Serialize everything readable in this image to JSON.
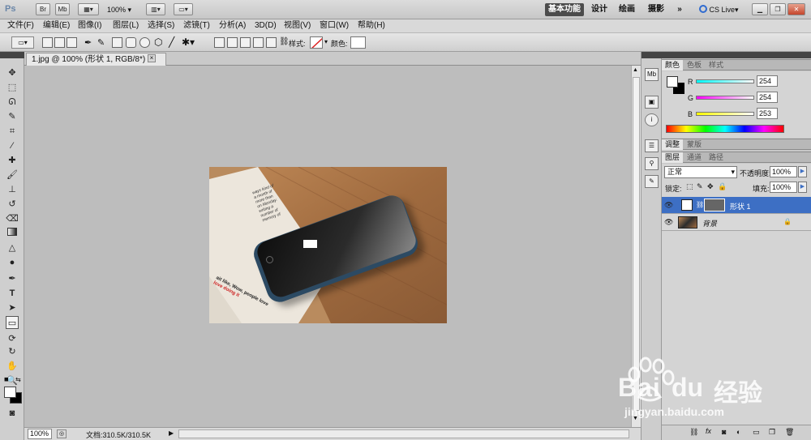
{
  "titlebar": {
    "app_logo": "Ps",
    "buttons": [
      "Br",
      "Mb"
    ],
    "zoom": "100%",
    "workspaces": [
      "基本功能",
      "设计",
      "绘画",
      "摄影"
    ],
    "more": "»",
    "cs_live": "CS Live"
  },
  "menu": [
    "文件(F)",
    "编辑(E)",
    "图像(I)",
    "图层(L)",
    "选择(S)",
    "滤镜(T)",
    "分析(A)",
    "3D(D)",
    "视图(V)",
    "窗口(W)",
    "帮助(H)"
  ],
  "options": {
    "style_label": "样式:",
    "color_label": "颜色:"
  },
  "document": {
    "tab_title": "1.jpg @ 100% (形状 1, RGB/8*) *",
    "tab_close": "×",
    "zoom_status": "100%",
    "doc_status": "文档:310.5K/310.5K"
  },
  "color_panel": {
    "tabs": [
      "颜色",
      "色板",
      "样式"
    ],
    "r_label": "R",
    "g_label": "G",
    "b_label": "B",
    "r_value": "254",
    "g_value": "254",
    "b_value": "253",
    "r": 254,
    "g": 254,
    "b": 253
  },
  "adjust_panel": {
    "tabs": [
      "调整",
      "蒙版"
    ]
  },
  "layers_panel": {
    "tabs": [
      "图层",
      "通道",
      "路径"
    ],
    "blend_mode": "正常",
    "opacity_label": "不透明度:",
    "opacity_value": "100%",
    "lock_label": "锁定:",
    "fill_label": "填充:",
    "fill_value": "100%",
    "layers": [
      {
        "name": "形状 1",
        "selected": true
      },
      {
        "name": "背景",
        "selected": false,
        "locked": true
      }
    ]
  },
  "watermark": {
    "brand": "Bai",
    "brand2": "经验",
    "url": "jingyan.baidu.com"
  },
  "canvas_text": {
    "page_lines": [
      "ways kind of",
      "a month of",
      "more than",
      "on Monday.",
      "writing a",
      "number of",
      "memory of"
    ],
    "red_text": "ait like, Wow, people love",
    "red_text2": "love doing it"
  },
  "colors": {
    "accent_blue": "#3d6fc4",
    "wood": "#a9774a"
  }
}
